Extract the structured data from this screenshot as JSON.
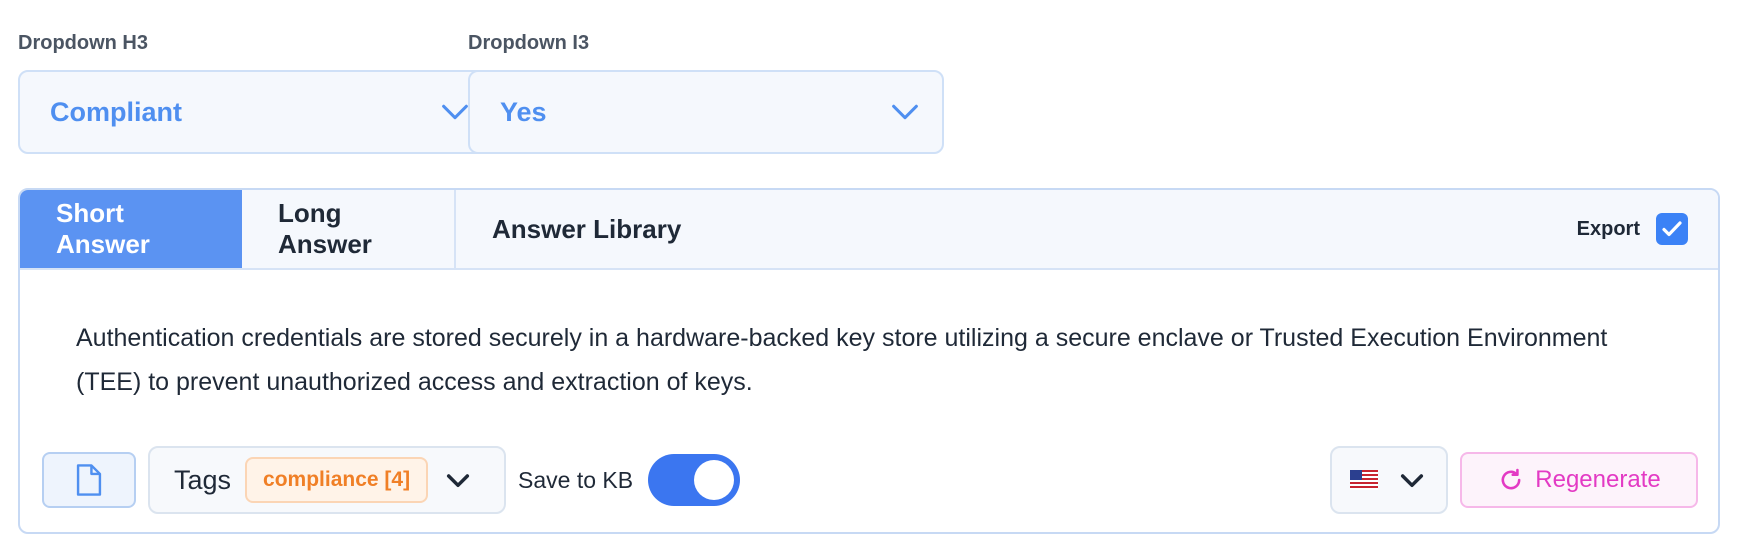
{
  "dropdown_h3": {
    "label": "Dropdown H3",
    "value": "Compliant"
  },
  "dropdown_i3": {
    "label": "Dropdown I3",
    "value": "Yes"
  },
  "tabs": {
    "short": "Short Answer",
    "long": "Long Answer",
    "library": "Answer Library",
    "active": "Short Answer"
  },
  "export": {
    "label": "Export",
    "checked": true
  },
  "answer": {
    "text": "Authentication credentials are stored securely in a hardware-backed key store utilizing a secure enclave or Trusted Execution Environment (TEE) to prevent unauthorized access and extraction of keys."
  },
  "footer": {
    "doc_icon": "document-icon",
    "tags_label": "Tags",
    "tag_chip": "compliance [4]",
    "save_to_kb_label": "Save to KB",
    "save_to_kb_on": true,
    "language_icon": "us-flag-icon",
    "regenerate_label": "Regenerate"
  },
  "colors": {
    "accent": "#5b93f2",
    "tag_orange": "#f07f26",
    "regen_pink": "#e33ac4"
  }
}
